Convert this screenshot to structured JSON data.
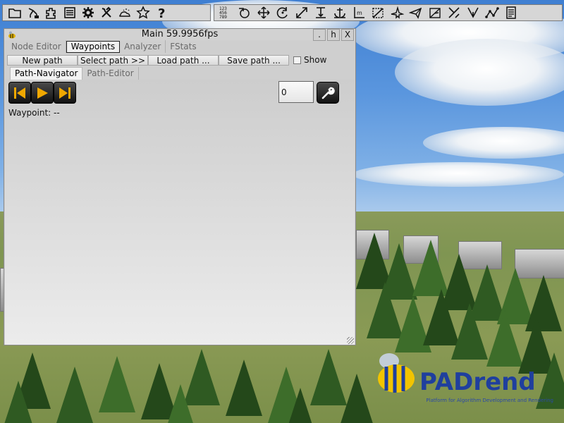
{
  "window": {
    "title": "Main 59.9956fps",
    "btn_dot": ".",
    "btn_h": "h",
    "btn_x": "X"
  },
  "tabs": [
    "Node Editor",
    "Waypoints",
    "Analyzer",
    "FStats"
  ],
  "active_tab": "Waypoints",
  "path_buttons": {
    "new": "New path",
    "select": "Select path >>",
    "load": "Load path ...",
    "save": "Save path ..."
  },
  "show_checkbox": {
    "label": "Show",
    "checked": false
  },
  "sub_tabs": [
    "Path-Navigator",
    "Path-Editor"
  ],
  "active_sub_tab": "Path-Navigator",
  "navigator": {
    "number_value": "0",
    "waypoint_label": "Waypoint: --"
  },
  "toolbar_left_icons": [
    "folder-icon",
    "scene-graph-icon",
    "plugin-icon",
    "list-icon",
    "gear-icon",
    "tools-icon",
    "weather-icon",
    "star-icon",
    "help-icon"
  ],
  "toolbar_right_icons": [
    "numbers-grid-icon",
    "orbit-camera-icon",
    "move-icon",
    "rotate-icon",
    "scale-icon",
    "snap-to-ground-icon",
    "anchor-icon",
    "measure-icon",
    "select-box-icon",
    "fly-icon",
    "airplane-icon",
    "node-select-icon",
    "transform-icon",
    "path-icon",
    "graph-icon",
    "document-icon"
  ],
  "logo": {
    "text": "PADrend",
    "subtitle": "Platform for Algorithm Development and Rendering"
  },
  "colors": {
    "window_bg": "#cfcfcf",
    "logo_blue": "#1f3f9e",
    "media_orange": "#f0a800",
    "sky": "#5a96de",
    "grass": "#7f9552"
  }
}
